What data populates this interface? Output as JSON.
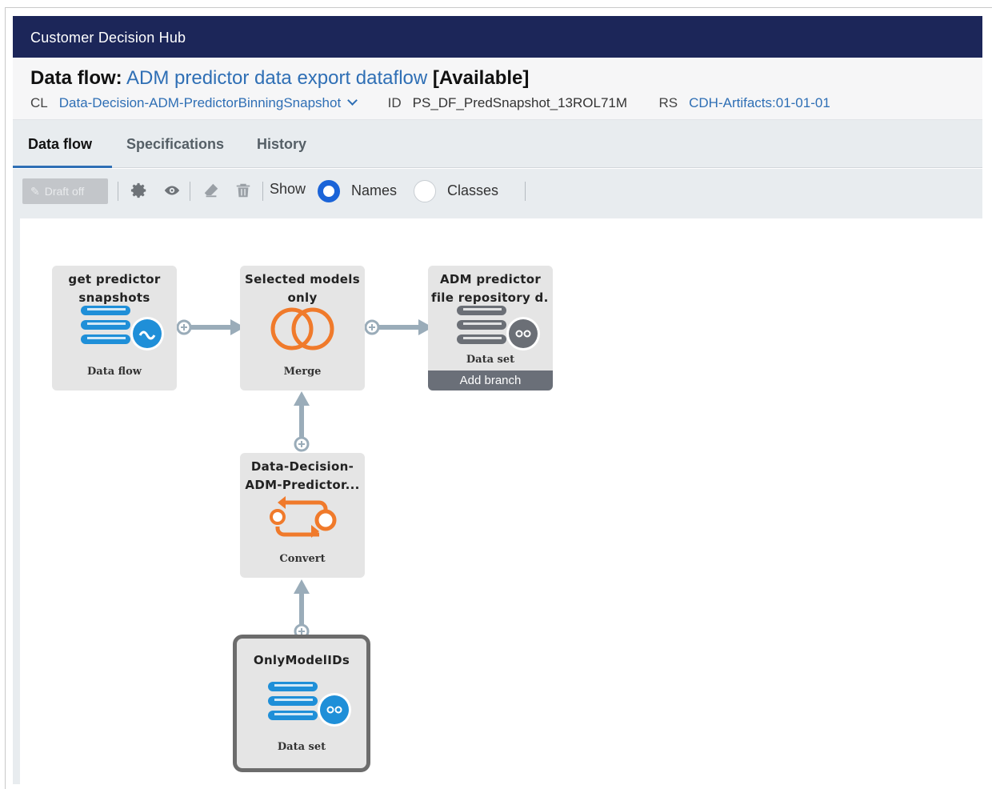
{
  "app": {
    "title": "Customer Decision Hub"
  },
  "header": {
    "title_prefix": "Data flow:",
    "title_name": "ADM predictor data export dataflow",
    "title_status": "[Available]",
    "class_key": "CL",
    "class_value": "Data-Decision-ADM-PredictorBinningSnapshot",
    "id_key": "ID",
    "id_value": "PS_DF_PredSnapshot_13ROL71M",
    "rs_key": "RS",
    "rs_value": "CDH-Artifacts:01-01-01"
  },
  "tabs": [
    {
      "label": "Data flow",
      "active": true
    },
    {
      "label": "Specifications",
      "active": false
    },
    {
      "label": "History",
      "active": false
    }
  ],
  "toolbar": {
    "draft_label": "Draft off",
    "show_label": "Show",
    "option_names": "Names",
    "option_classes": "Classes",
    "selected_option": "Names",
    "icons": [
      "pencil-icon",
      "gear-icon",
      "eye-icon",
      "eraser-icon",
      "trash-icon"
    ]
  },
  "nodes": {
    "source": {
      "title_line1": "get predictor",
      "title_line2": "snapshots",
      "type": "Data flow",
      "icon": "dataflow-icon"
    },
    "merge": {
      "title_line1": "Selected models",
      "title_line2": "only",
      "type": "Merge",
      "icon": "merge-icon"
    },
    "destination": {
      "title_line1": "ADM predictor",
      "title_line2": "file repository d...",
      "type": "Data set",
      "icon": "dataset-icon",
      "action": "Add branch"
    },
    "convert": {
      "title_line1": "Data-Decision-",
      "title_line2": "ADM-Predictor...",
      "type": "Convert",
      "icon": "convert-icon"
    },
    "secondary_source": {
      "title_line1": "OnlyModelIDs",
      "type": "Data set",
      "icon": "dataset-icon",
      "selected": true
    }
  },
  "colors": {
    "app_bar": "#1c2659",
    "link": "#2f6fb5",
    "radio_selected": "#1b64d8",
    "node_bg": "#e5e5e5",
    "icon_blue": "#1f8fd8",
    "icon_orange": "#f07a2b",
    "icon_gray": "#6b6f76",
    "connector": "#9aacb9"
  }
}
